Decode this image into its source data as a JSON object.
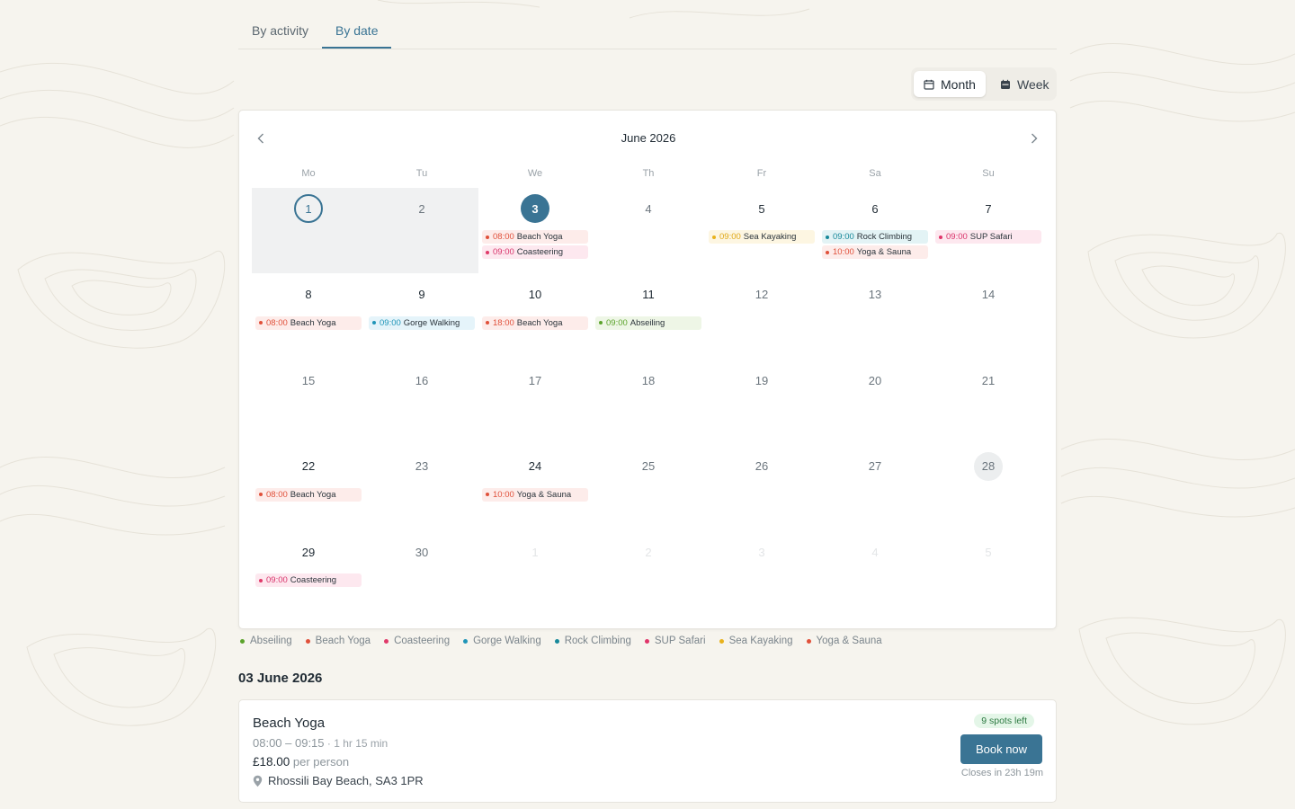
{
  "tabs": [
    {
      "label": "By activity",
      "active": false
    },
    {
      "label": "By date",
      "active": true
    }
  ],
  "view_toggle": {
    "month_label": "Month",
    "week_label": "Week",
    "selected": "Month"
  },
  "calendar": {
    "title": "June 2026",
    "weekdays": [
      "Mo",
      "Tu",
      "We",
      "Th",
      "Fr",
      "Sa",
      "Su"
    ],
    "weeks": [
      [
        {
          "day": "1",
          "state": "today-past",
          "events": []
        },
        {
          "day": "2",
          "state": "past",
          "events": []
        },
        {
          "day": "3",
          "state": "selected",
          "events": [
            {
              "time": "08:00",
              "name": "Beach Yoga",
              "activity": "Beach Yoga"
            },
            {
              "time": "09:00",
              "name": "Coasteering",
              "activity": "Coasteering"
            }
          ]
        },
        {
          "day": "4",
          "state": "normal",
          "events": []
        },
        {
          "day": "5",
          "state": "normal",
          "events": [
            {
              "time": "09:00",
              "name": "Sea Kayaking",
              "activity": "Sea Kayaking"
            }
          ]
        },
        {
          "day": "6",
          "state": "normal",
          "events": [
            {
              "time": "09:00",
              "name": "Rock Climbing",
              "activity": "Rock Climbing"
            },
            {
              "time": "10:00",
              "name": "Yoga & Sauna",
              "activity": "Yoga & Sauna"
            }
          ]
        },
        {
          "day": "7",
          "state": "normal",
          "events": [
            {
              "time": "09:00",
              "name": "SUP Safari",
              "activity": "SUP Safari"
            }
          ]
        }
      ],
      [
        {
          "day": "8",
          "state": "normal",
          "events": [
            {
              "time": "08:00",
              "name": "Beach Yoga",
              "activity": "Beach Yoga"
            }
          ]
        },
        {
          "day": "9",
          "state": "normal",
          "events": [
            {
              "time": "09:00",
              "name": "Gorge Walking",
              "activity": "Gorge Walking"
            }
          ]
        },
        {
          "day": "10",
          "state": "normal",
          "events": [
            {
              "time": "18:00",
              "name": "Beach Yoga",
              "activity": "Beach Yoga"
            }
          ]
        },
        {
          "day": "11",
          "state": "normal",
          "events": [
            {
              "time": "09:00",
              "name": "Abseiling",
              "activity": "Abseiling"
            }
          ]
        },
        {
          "day": "12",
          "state": "normal",
          "events": []
        },
        {
          "day": "13",
          "state": "normal",
          "events": []
        },
        {
          "day": "14",
          "state": "normal",
          "events": []
        }
      ],
      [
        {
          "day": "15",
          "state": "normal",
          "events": []
        },
        {
          "day": "16",
          "state": "normal",
          "events": []
        },
        {
          "day": "17",
          "state": "normal",
          "events": []
        },
        {
          "day": "18",
          "state": "normal",
          "events": []
        },
        {
          "day": "19",
          "state": "normal",
          "events": []
        },
        {
          "day": "20",
          "state": "normal",
          "events": []
        },
        {
          "day": "21",
          "state": "normal",
          "events": []
        }
      ],
      [
        {
          "day": "22",
          "state": "normal",
          "events": [
            {
              "time": "08:00",
              "name": "Beach Yoga",
              "activity": "Beach Yoga"
            }
          ]
        },
        {
          "day": "23",
          "state": "normal",
          "events": []
        },
        {
          "day": "24",
          "state": "normal",
          "events": [
            {
              "time": "10:00",
              "name": "Yoga & Sauna",
              "activity": "Yoga & Sauna"
            }
          ]
        },
        {
          "day": "25",
          "state": "normal",
          "events": []
        },
        {
          "day": "26",
          "state": "normal",
          "events": []
        },
        {
          "day": "27",
          "state": "normal",
          "events": []
        },
        {
          "day": "28",
          "state": "hover",
          "events": []
        }
      ],
      [
        {
          "day": "29",
          "state": "normal",
          "events": [
            {
              "time": "09:00",
              "name": "Coasteering",
              "activity": "Coasteering"
            }
          ]
        },
        {
          "day": "30",
          "state": "normal",
          "events": []
        },
        {
          "day": "1",
          "state": "outside",
          "events": []
        },
        {
          "day": "2",
          "state": "outside",
          "events": []
        },
        {
          "day": "3",
          "state": "outside",
          "events": []
        },
        {
          "day": "4",
          "state": "outside",
          "events": []
        },
        {
          "day": "5",
          "state": "outside",
          "events": []
        }
      ]
    ]
  },
  "activity_colors": {
    "Abseiling": {
      "dot": "#5ba32b",
      "bg": "#eef6e6",
      "time": "#5ba32b"
    },
    "Beach Yoga": {
      "dot": "#e0503a",
      "bg": "#fdecea",
      "time": "#e0503a"
    },
    "Coasteering": {
      "dot": "#e03a6a",
      "bg": "#fde8ef",
      "time": "#d8336a"
    },
    "Gorge Walking": {
      "dot": "#1f95b8",
      "bg": "#e5f4fa",
      "time": "#1f95b8"
    },
    "Rock Climbing": {
      "dot": "#17889a",
      "bg": "#e3f3f5",
      "time": "#17889a"
    },
    "SUP Safari": {
      "dot": "#e0356a",
      "bg": "#fde8ef",
      "time": "#d8336a"
    },
    "Sea Kayaking": {
      "dot": "#e8b21c",
      "bg": "#fdf6e2",
      "time": "#e0a817"
    },
    "Yoga & Sauna": {
      "dot": "#e0503a",
      "bg": "#fdecea",
      "time": "#e0503a"
    }
  },
  "legend": [
    "Abseiling",
    "Beach Yoga",
    "Coasteering",
    "Gorge Walking",
    "Rock Climbing",
    "SUP Safari",
    "Sea Kayaking",
    "Yoga & Sauna"
  ],
  "selected_date_heading": "03 June 2026",
  "booking": {
    "title": "Beach Yoga",
    "time": "08:00 – 09:15",
    "duration": " · 1 hr 15 min",
    "price": "£18.00",
    "price_unit": " per person",
    "location": "Rhossili Bay Beach, SA3 1PR",
    "spots": "9 spots left",
    "book_label": "Book now",
    "closes": "Closes in 23h 19m"
  }
}
